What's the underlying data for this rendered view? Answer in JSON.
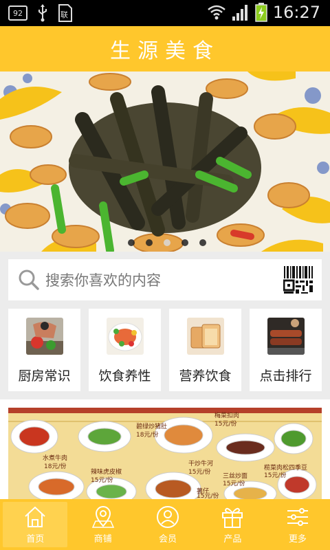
{
  "status_bar": {
    "notification_badge": "92",
    "time": "16:27",
    "icons": [
      "notification-badge-icon",
      "usb-icon",
      "sim-icon",
      "wifi-icon",
      "signal-icon",
      "battery-charging-icon"
    ]
  },
  "header": {
    "title": "生源美食"
  },
  "banner": {
    "slide_count": 5,
    "active_slide": 3
  },
  "search": {
    "placeholder": "搜索你喜欢的内容",
    "scan_icon": "qr-scan-icon"
  },
  "categories": [
    {
      "label": "厨房常识",
      "icon": "kitchen-photo"
    },
    {
      "label": "饮食养性",
      "icon": "platter-photo"
    },
    {
      "label": "营养饮食",
      "icon": "bread-photo"
    },
    {
      "label": "点击排行",
      "icon": "grill-photo"
    }
  ],
  "poster": {
    "items": [
      {
        "name": "水煮牛肉",
        "price": "18元/份"
      },
      {
        "name": "碧绿炒猪肚",
        "price": "18元/份"
      },
      {
        "name": "梅菜扣肉",
        "price": "15元/份"
      },
      {
        "name": "榄菜肉松四季豆",
        "price": "15元/份"
      },
      {
        "name": "干炒牛河",
        "price": "15元/份"
      },
      {
        "name": "辣味虎皮椒",
        "price": "15元/份"
      },
      {
        "name": "三丝炒面",
        "price": "15元/份"
      },
      {
        "name": "薯仔",
        "price": "15元/份"
      }
    ]
  },
  "bottom_nav": [
    {
      "label": "首页",
      "icon": "home-icon",
      "active": true
    },
    {
      "label": "商铺",
      "icon": "map-pin-icon",
      "active": false
    },
    {
      "label": "会员",
      "icon": "user-icon",
      "active": false
    },
    {
      "label": "产品",
      "icon": "gift-icon",
      "active": false
    },
    {
      "label": "更多",
      "icon": "sliders-icon",
      "active": false
    }
  ],
  "colors": {
    "brand": "#ffc72c",
    "background": "#ececec"
  }
}
